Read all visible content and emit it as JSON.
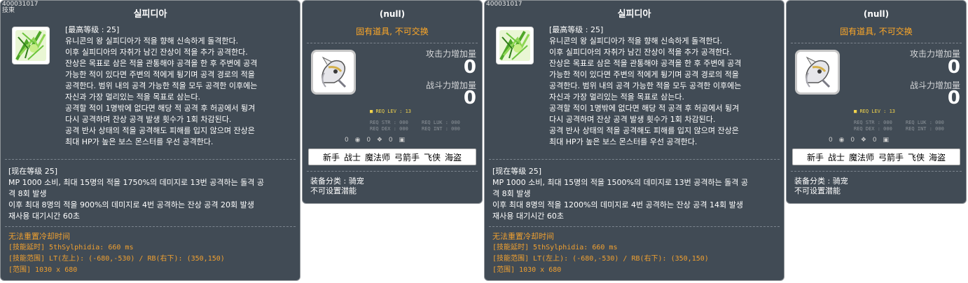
{
  "skill_panels": [
    {
      "id": "400031017",
      "id2": "技東",
      "title": "실피디아",
      "desc": [
        "[最高等级 : 25]",
        "유니콘의 왕 실피디아가 적을 향해 신속하게 돌격한다.",
        "이후 실피디아의 자취가 남긴 잔상이 적을 추가 공격한다.",
        "잔상은 목표로 삼은 적을 관통해야 공격을 한 후 주변에 공격",
        "가능한 적이 있다면 주변의 적에게 튕기며 공격 경로의 적을",
        "공격한다. 범위 내의 공격 가능한 적을 모두 공격한 이후에는",
        "자신과 가장 멀리있는 적을 목표로 삼는다.",
        "공격할 적이 1명밖에 없다면 해당 적 공격 후 허공에서 튕겨",
        "다시 공격하며 잔상 공격 발생 횟수가 1회 차감된다.",
        "공격 반사 상태의 적을 공격해도 피해를 입지 않으며 잔상은",
        "최대 HP가 높은 보스 몬스터를 우선 공격한다."
      ],
      "current": [
        "[现在等级 25]",
        "MP 1000 소비, 최대 15명의 적을 1750%의 데미지로 13번 공격하는 돌격 공",
        "격 8회 발생",
        "이후 최대 8명의 적을 900%의 데미지로 4번 공격하는 잔상 공격 20회 발생",
        "재사용 대기시간 60초"
      ],
      "extra": [
        "无法重置冷却时间",
        "[技能延时] 5thSylphidia: 660 ms",
        "[技能范围] LT(左上): (-680,-530) / RB(右下): (350,150)",
        "[范围] 1030 x 680"
      ]
    },
    {
      "id": "400031017",
      "id2": "",
      "title": "실피디아",
      "desc": [
        "[最高等级 : 25]",
        "유니콘의 왕 실피디아가 적을 향해 신속하게 돌격한다.",
        "이후 실피디아의 자취가 남긴 잔상이 적을 추가 공격한다.",
        "잔상은 목표로 삼은 적을 관통해야 공격을 한 후 주변에 공격",
        "가능한 적이 있다면 주변의 적에게 튕기며 공격 경로의 적을",
        "공격한다. 범위 내의 공격 가능한 적을 모두 공격한 이후에는",
        "자신과 가장 멀리있는 적을 목표로 삼는다.",
        "공격할 적이 1명밖에 없다면 해당 적 공격 후 허공에서 튕겨",
        "다시 공격하며 잔상 공격 발생 횟수가 1회 차감된다.",
        "공격 반사 상태의 적을 공격해도 피해를 입지 않으며 잔상은",
        "최대 HP가 높은 보스 몬스터를 우선 공격한다."
      ],
      "current": [
        "[现在等级 25]",
        "MP 1000 소비, 최대 15명의 적을 1500%의 데미지로 13번 공격하는 돌격 공",
        "격 8회 발생",
        "이후 최대 8명의 적을 1200%의 데미지로 4번 공격하는 잔상 공격 14회 발생",
        "재사용 대기시간 60초"
      ],
      "extra": [
        "无法重置冷却时间",
        "[技能延时] 5thSylphidia: 660 ms",
        "[技能范围] LT(左上): (-680,-530) / RB(右下): (350,150)",
        "[范围] 1030 x 680"
      ]
    }
  ],
  "item_panels": [
    {
      "title": "(null)",
      "notice": "固有道具, 不可交换",
      "attack_label": "攻击力增加量",
      "attack_value": "0",
      "power_label": "战斗力增加量",
      "power_value": "0",
      "req_lev": "REQ LEV :  13",
      "req_str": "REQ STR : 000",
      "req_dex": "REQ DEX : 000",
      "req_luk": "REQ LUK : 000",
      "req_int": "REQ INT : 000",
      "stat_a": "0",
      "stat_b": "0",
      "stat_c": "0",
      "jobs": [
        "新手",
        "战士",
        "魔法师",
        "弓箭手",
        "飞侠",
        "海盗"
      ],
      "category": "装备分类 : 骑宠",
      "potential": "不可设置潜能"
    },
    {
      "title": "(null)",
      "notice": "固有道具, 不可交换",
      "attack_label": "攻击力增加量",
      "attack_value": "0",
      "power_label": "战斗力增加量",
      "power_value": "0",
      "req_lev": "REQ LEV :  13",
      "req_str": "REQ STR : 000",
      "req_dex": "REQ DEX : 000",
      "req_luk": "REQ LUK : 000",
      "req_int": "REQ INT : 000",
      "stat_a": "0",
      "stat_b": "0",
      "stat_c": "0",
      "jobs": [
        "新手",
        "战士",
        "魔法师",
        "弓箭手",
        "飞侠",
        "海盗"
      ],
      "category": "装备分类 : 骑宠",
      "potential": "不可设置潜能"
    }
  ],
  "colors": {
    "panel_bg": "#414b55",
    "accent_orange": "#f0a030",
    "req_yellow": "#f2d44c",
    "icon_green": "#6cc43c"
  }
}
